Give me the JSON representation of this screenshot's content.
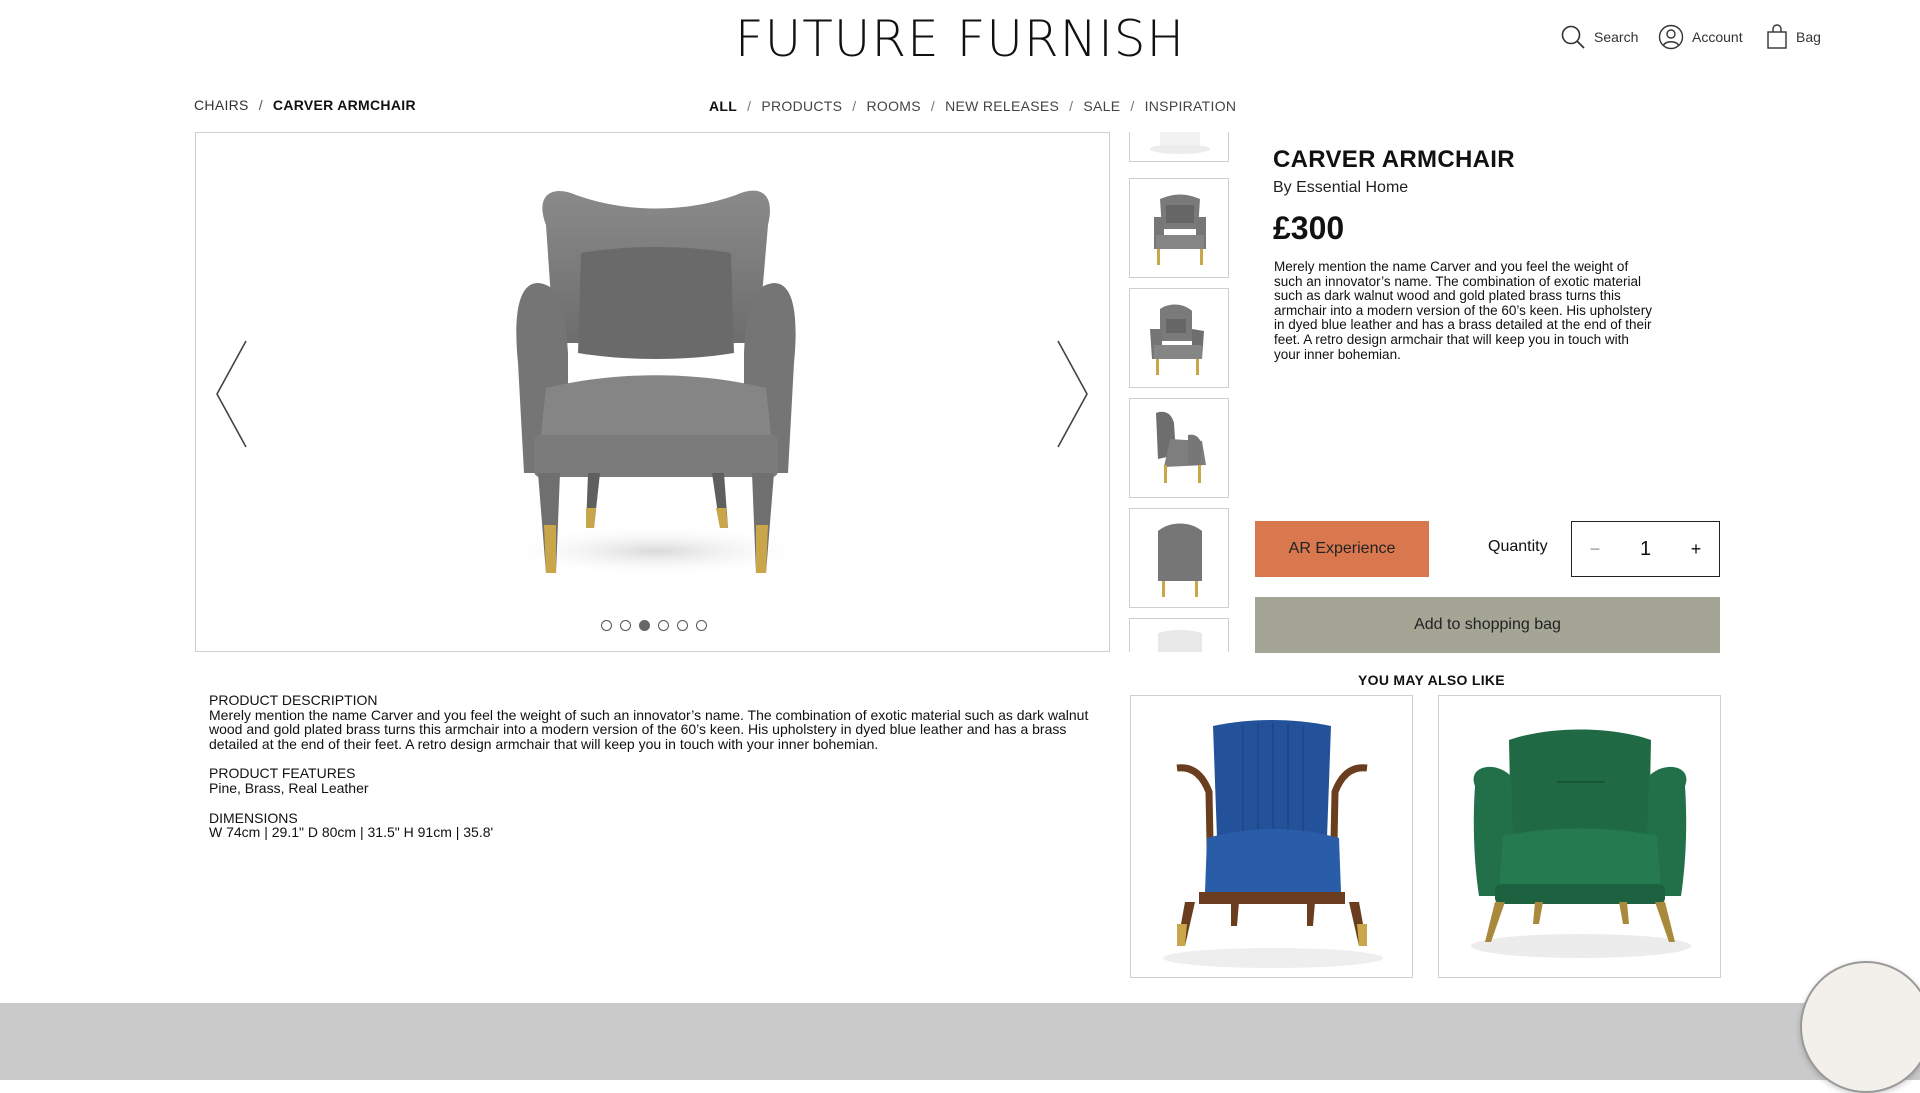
{
  "brand": {
    "name": "FUTURE FURNISH"
  },
  "header": {
    "search_label": "Search",
    "account_label": "Account",
    "bag_label": "Bag"
  },
  "breadcrumb": {
    "items": [
      "CHAIRS",
      "CARVER ARMCHAIR"
    ],
    "separator": "/"
  },
  "nav": {
    "items": [
      "ALL",
      "PRODUCTS",
      "ROOMS",
      "NEW RELEASES",
      "SALE",
      "INSPIRATION"
    ],
    "active": "ALL",
    "separator": "/"
  },
  "gallery": {
    "slide_count": 6,
    "active_slide": 3,
    "thumbnail_count": 6
  },
  "product": {
    "title": "CARVER ARMCHAIR",
    "brand_line": "By Essential Home",
    "price": "£300",
    "short_description": "Merely mention the name Carver and you feel the weight of such an innovator’s name. The combination of exotic material such as dark walnut wood and gold plated brass turns this armchair into a modern version of the 60’s keen. His upholstery in dyed blue leather and has a brass detailed at the end of their feet. A retro design armchair that will keep you in touch with your inner bohemian."
  },
  "actions": {
    "ar_label": "AR Experience",
    "quantity_label": "Quantity",
    "quantity_minus": "−",
    "quantity_value": "1",
    "quantity_plus": "+",
    "add_to_bag_label": "Add to shopping bag"
  },
  "details": {
    "description_heading": "PRODUCT DESCRIPTION",
    "description_text": "Merely mention the name Carver and you feel the weight of such an innovator’s name. The combination of exotic material such as dark walnut wood and gold plated brass turns this armchair into a modern version of the 60’s keen. His upholstery in dyed blue leather and has a brass detailed at the end of their feet. A retro design armchair that will keep you in touch with your inner bohemian.",
    "features_heading": "PRODUCT FEATURES",
    "features_text": "Pine, Brass, Real Leather",
    "dimensions_heading": "DIMENSIONS",
    "dimensions_text": "W 74cm | 29.1\" D 80cm | 31.5\" H 91cm | 35.8'"
  },
  "also_like": {
    "title": "YOU MAY ALSO LIKE",
    "items": [
      {
        "image": "blue-wooden-armchair"
      },
      {
        "image": "green-velvet-armchair"
      }
    ]
  },
  "colors": {
    "ar_button": "#d9784f",
    "add_to_bag_button": "#a4a595",
    "footer": "#cacaca",
    "chair_grey": "#7a7a7a",
    "brass": "#c9a64a"
  }
}
